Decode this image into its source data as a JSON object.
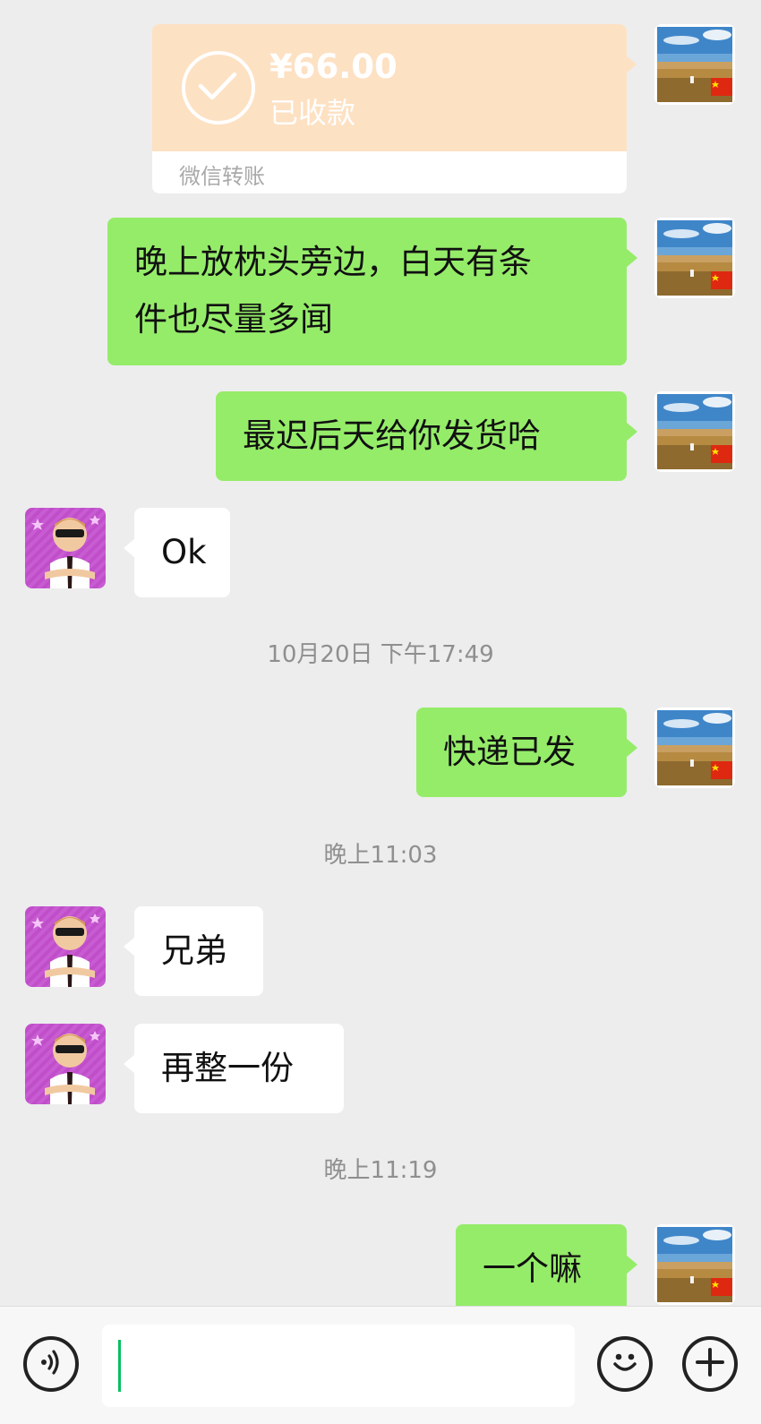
{
  "transfer": {
    "amount": "¥66.00",
    "status": "已收款",
    "footer": "微信转账"
  },
  "messages": [
    {
      "from": "me",
      "text_lines": [
        "晚上放枕头旁边，白天有条",
        "件也尽量多闻"
      ]
    },
    {
      "from": "me",
      "text": "最迟后天给你发货哈"
    },
    {
      "from": "other",
      "text": "Ok"
    },
    {
      "timestamp": "10月20日 下午17:49"
    },
    {
      "from": "me",
      "text": "快递已发"
    },
    {
      "timestamp": "晚上11:03"
    },
    {
      "from": "other",
      "text": "兄弟"
    },
    {
      "from": "other",
      "text": "再整一份"
    },
    {
      "timestamp": "晚上11:19"
    },
    {
      "from": "me",
      "text": "一个嘛"
    }
  ],
  "input_bar": {
    "input_value": "",
    "icons": [
      "voice-icon",
      "emoji-icon",
      "plus-icon"
    ]
  },
  "colors": {
    "background": "#ededed",
    "my_bubble": "#95ec69",
    "their_bubble": "#ffffff",
    "transfer_card": "#fde1c3",
    "caret": "#07c160"
  }
}
